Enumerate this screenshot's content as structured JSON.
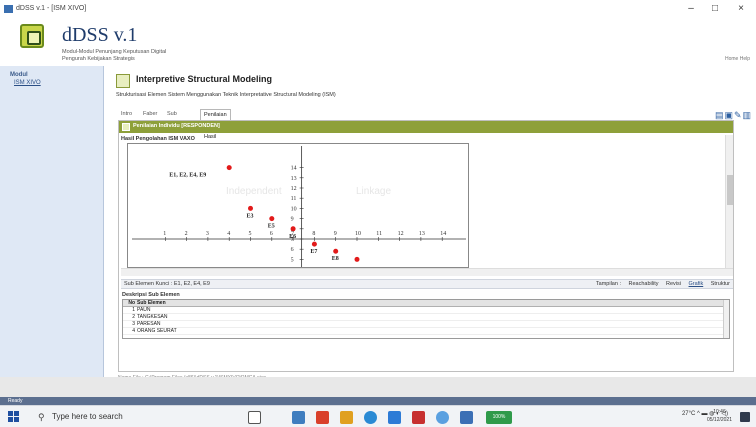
{
  "window": {
    "title": "dDSS v.1 - [ISM XIVO]",
    "minimize": "–",
    "maximize": "□",
    "close": "×"
  },
  "header": {
    "brand": "dDSS v.1",
    "subtitle_1": "Modul-Modul Penunjang Keputusan Digital",
    "subtitle_2": "Pengurah Kebijakan Strategis",
    "right_text": "Home   Help"
  },
  "sidebar": {
    "heading": "Modul",
    "items": [
      {
        "label": "ISM XIVO"
      }
    ]
  },
  "main": {
    "title": "Interpretive Structural Modeling",
    "description": "Strukturisasi Elemen Sistem Menggunakan Teknik Interpretative Structural Modeling (ISM)",
    "tabs": [
      {
        "label": "Intro"
      },
      {
        "label": "Faber"
      },
      {
        "label": "Sub Elemen"
      },
      {
        "label": "Penilaian dan Hasil"
      }
    ],
    "panel_title": "Penilaian Individu [RESPONDEN]",
    "result_heading": "Hasil Pengolahan ISM VAXO",
    "sub_element_line": "Sub Elemen Kunci : E1, E2, E4, E9",
    "view_options": [
      {
        "label": "Tampilan :"
      },
      {
        "label": "Reachability"
      },
      {
        "label": "Revisi"
      },
      {
        "label": "Grafik"
      },
      {
        "label": "Struktur"
      }
    ],
    "desc_heading": "Deskripsi Sub Elemen",
    "table": {
      "headers": [
        "No",
        "Sub Elemen"
      ],
      "rows": [
        {
          "no": "1",
          "name": "PAUN"
        },
        {
          "no": "2",
          "name": "TANGKESAN"
        },
        {
          "no": "3",
          "name": "PARESAN"
        },
        {
          "no": "4",
          "name": "ORANG SEURAT"
        }
      ]
    },
    "footer_path": "Nama File : C:\\Program Files (x86)\\dDSS v.1\\ISMXIVO\\RMCA.xivo"
  },
  "chart_data": {
    "type": "scatter",
    "quadrant_labels": [
      "Independent",
      "Linkage"
    ],
    "x_ticks": [
      1,
      2,
      3,
      4,
      5,
      6,
      7,
      8,
      9,
      10,
      11,
      12,
      13,
      14
    ],
    "y_ticks": [
      14,
      13,
      12,
      11,
      10,
      9,
      8,
      7,
      6,
      5
    ],
    "xlim": [
      0,
      14
    ],
    "ylim": [
      4,
      14
    ],
    "points": [
      {
        "label": "E1, E2, E4, E9",
        "x": 4,
        "y": 14
      },
      {
        "label": "E3",
        "x": 5,
        "y": 10
      },
      {
        "label": "E5",
        "x": 6,
        "y": 9
      },
      {
        "label": "E6",
        "x": 7,
        "y": 8
      },
      {
        "label": "E7",
        "x": 8,
        "y": 6.5
      },
      {
        "label": "E8",
        "x": 9,
        "y": 5.8
      },
      {
        "label": "",
        "x": 10,
        "y": 5
      }
    ],
    "color": "#e21a1a"
  },
  "status": {
    "text": "Ready"
  },
  "taskbar": {
    "search_placeholder": "Type here to search",
    "weather": "27°C",
    "battery": "100%",
    "time": "10:46",
    "date": "05/12/2021"
  }
}
